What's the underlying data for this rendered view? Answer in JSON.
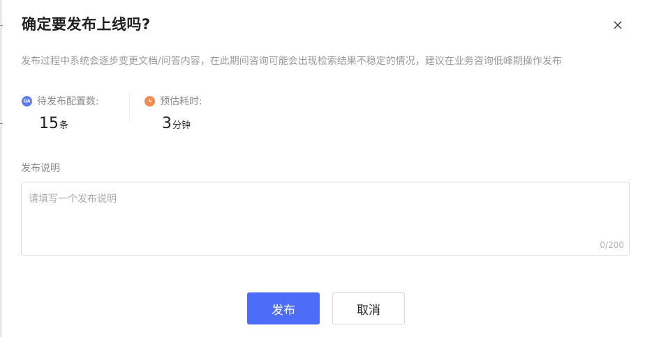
{
  "dialog": {
    "title": "确定要发布上线吗?",
    "description": "发布过程中系统会逐步变更文档/问答内容，在此期间咨询可能会出现检索结果不稳定的情况，建议在业务咨询低峰期操作发布"
  },
  "stats": {
    "pending_configs": {
      "icon": "qa-icon",
      "icon_text": "QA",
      "label": "待发布配置数:",
      "value": "15",
      "unit": "条"
    },
    "estimated_time": {
      "icon": "clock-icon",
      "label": "预估耗时:",
      "value": "3",
      "unit": "分钟"
    }
  },
  "notes": {
    "label": "发布说明",
    "placeholder": "请填写一个发布说明",
    "value": "",
    "counter": "0/200"
  },
  "buttons": {
    "publish_label": "发布",
    "cancel_label": "取消"
  },
  "colors": {
    "primary": "#4d6cf7",
    "qa_badge": "#5b7cf5",
    "clock_badge": "#f58a4b"
  }
}
